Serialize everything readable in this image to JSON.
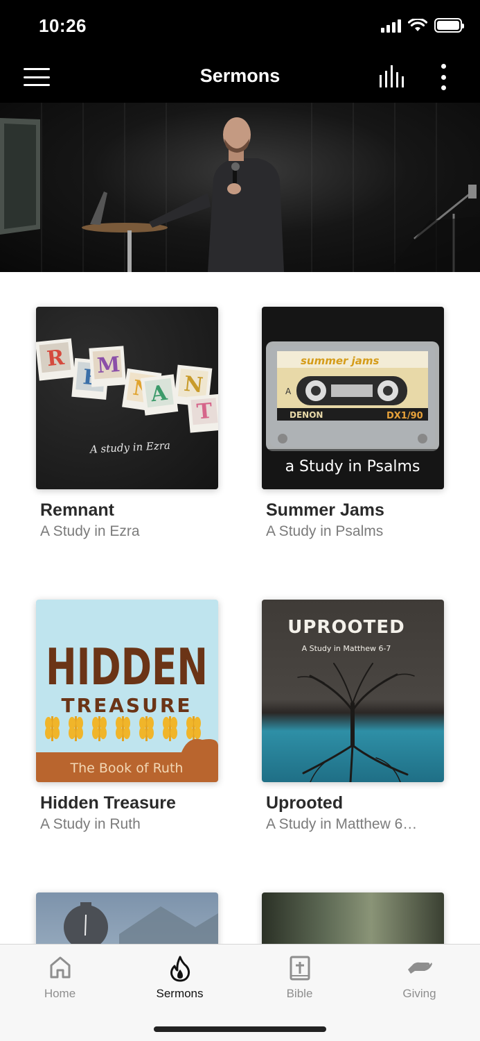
{
  "status_bar": {
    "time": "10:26"
  },
  "nav": {
    "title": "Sermons"
  },
  "series": [
    {
      "title": "Remnant",
      "subtitle": "A Study in Ezra",
      "art_text": "A study in Ezra",
      "art_letters": [
        "R",
        "E",
        "M",
        "N",
        "A",
        "N",
        "T"
      ]
    },
    {
      "title": "Summer Jams",
      "subtitle": "A Study in Psalms",
      "art_text": "a Study in Psalms",
      "tape_label": "summer jams",
      "tape_brand": "DENON",
      "tape_model": "DX1/90",
      "tape_side": "A"
    },
    {
      "title": "Hidden Treasure",
      "subtitle": "A Study in Ruth",
      "art_line1": "HIDDEN",
      "art_line2": "TREASURE",
      "art_line3": "The Book of Ruth"
    },
    {
      "title": "Uprooted",
      "subtitle": "A Study in Matthew 6…",
      "art_line1": "UPROOTED",
      "art_line2": "A Study in Matthew 6-7"
    }
  ],
  "tabs": [
    {
      "label": "Home",
      "icon": "home-icon"
    },
    {
      "label": "Sermons",
      "icon": "flame-icon",
      "active": true
    },
    {
      "label": "Bible",
      "icon": "bible-icon"
    },
    {
      "label": "Giving",
      "icon": "giving-hand-icon"
    }
  ],
  "colors": {
    "header_bg": "#000000",
    "tab_active": "#111111",
    "tab_inactive": "#8e8e8e",
    "subtitle": "#7b7b7b"
  }
}
